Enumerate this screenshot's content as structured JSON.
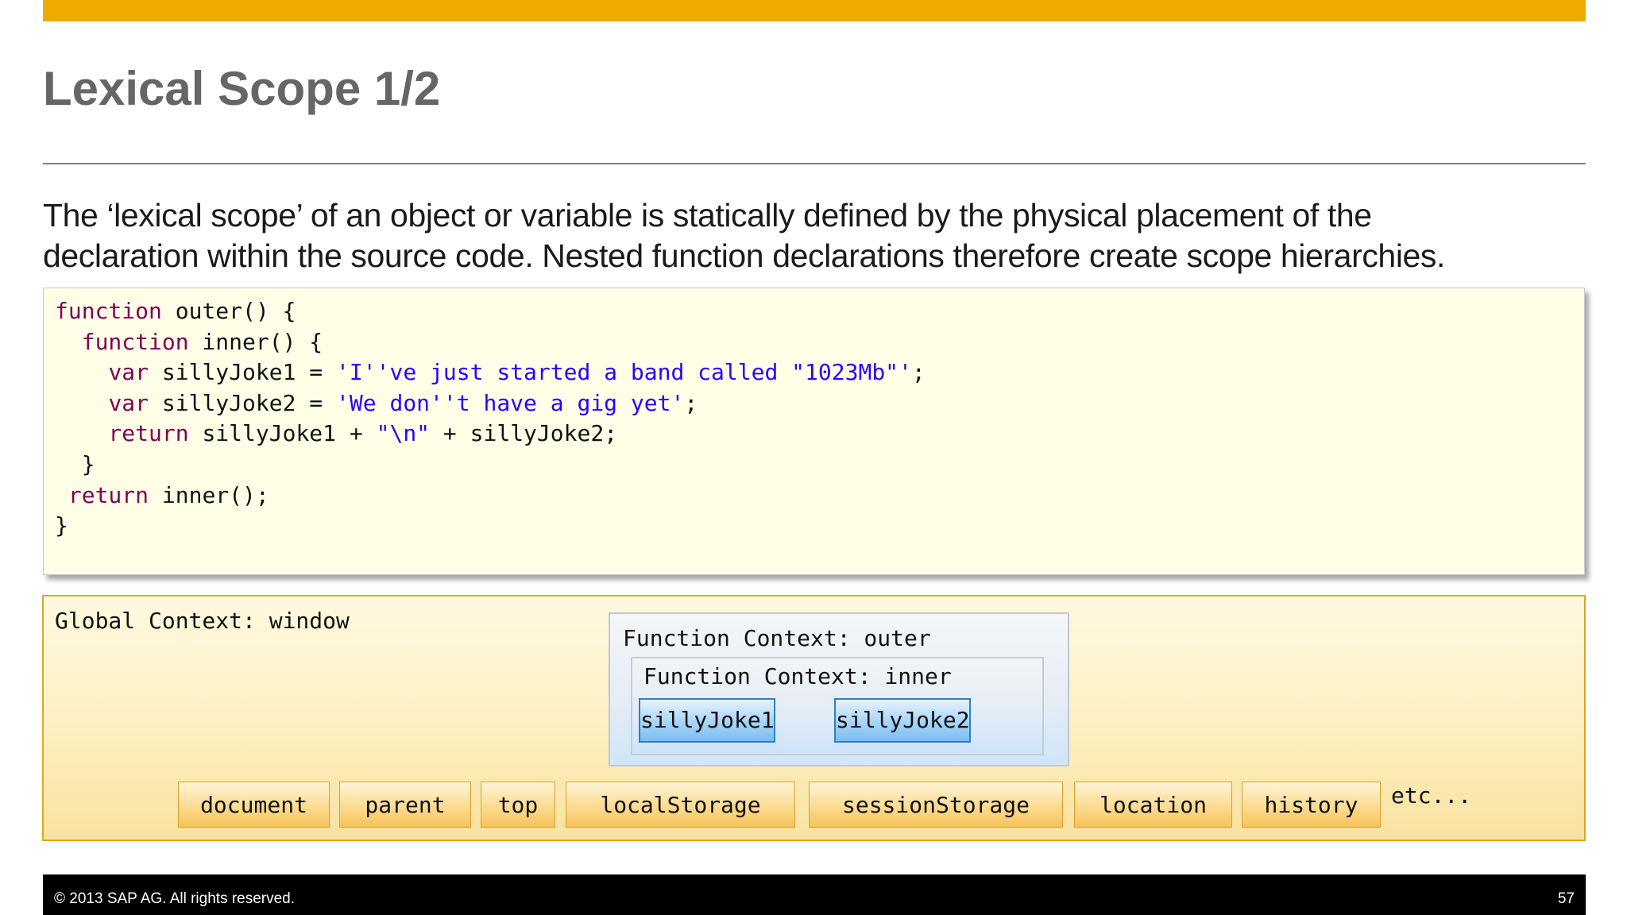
{
  "slide": {
    "title": "Lexical Scope 1/2",
    "intro_line1": "The ‘lexical scope’ of an object or variable is statically defined by the physical placement of the",
    "intro_line2": "declaration within the source code.  Nested function declarations therefore create scope hierarchies."
  },
  "code": {
    "l1_kw": "function",
    "l1_rest": " outer() {",
    "l2_kw": "function",
    "l2_rest": " inner() {",
    "l3_kw": "var",
    "l3_mid": " sillyJoke1 = ",
    "l3_str": "'I''ve just started a band called \"1023Mb\"'",
    "l3_end": ";",
    "l4_kw": "var",
    "l4_mid": " sillyJoke2 = ",
    "l4_str": "'We don''t have a gig yet'",
    "l4_end": ";",
    "l5_kw": "return",
    "l5_mid": " sillyJoke1 + ",
    "l5_str": "\"\\n\"",
    "l5_end": " + sillyJoke2;",
    "l6": "}",
    "l7_kw": "return",
    "l7_rest": " inner();",
    "l8": "}"
  },
  "diagram": {
    "global_label": "Global Context: window",
    "outer_label": "Function Context: outer",
    "inner_label": "Function Context: inner",
    "vars": [
      "sillyJoke1",
      "sillyJoke2"
    ],
    "window_props": [
      "document",
      "parent",
      "top",
      "localStorage",
      "sessionStorage",
      "location",
      "history"
    ],
    "etc_label": "etc..."
  },
  "footer": {
    "copyright": "©  2013 SAP AG. All rights reserved.",
    "page_number": "57"
  },
  "colors": {
    "accent_bar": "#f0ab00",
    "keyword": "#7f0055",
    "string": "#2a00ff"
  }
}
